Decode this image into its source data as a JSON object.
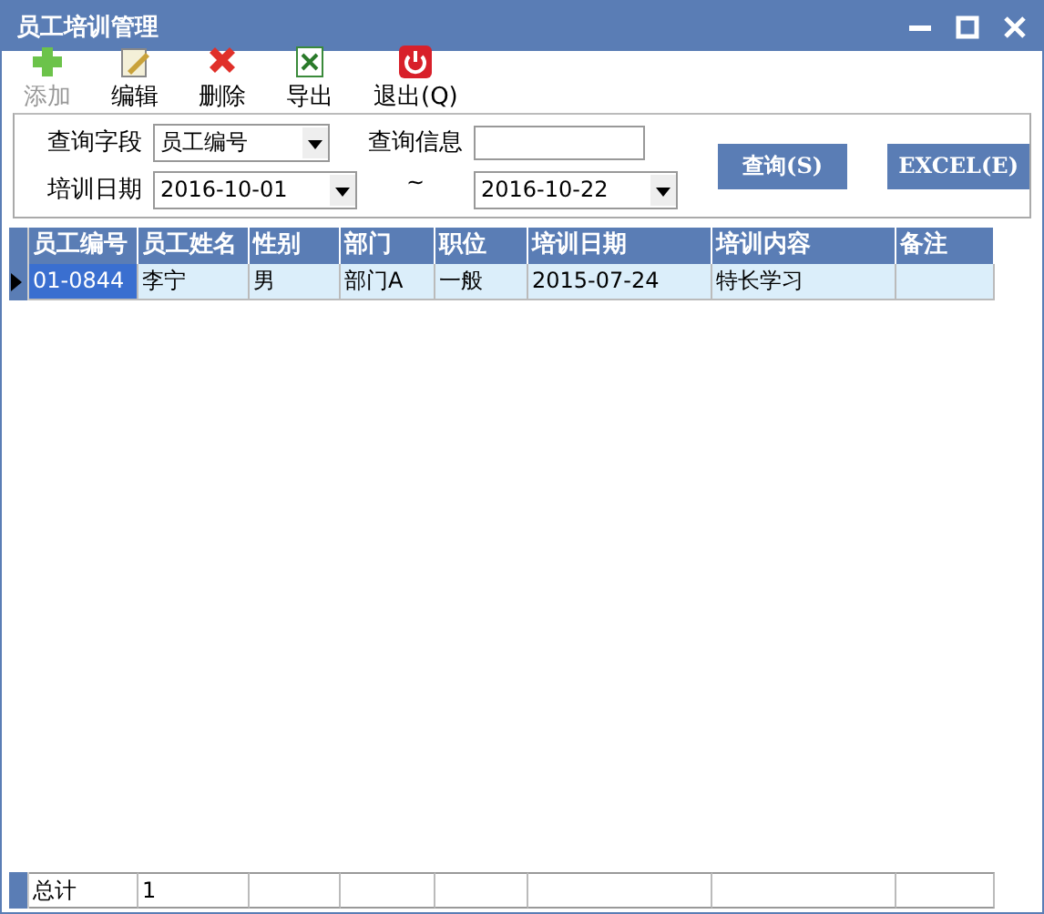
{
  "window": {
    "title": "员工培训管理"
  },
  "toolbar": [
    {
      "kind": "add",
      "label": "添加",
      "disabled": true
    },
    {
      "kind": "edit",
      "label": "编辑",
      "disabled": false
    },
    {
      "kind": "delete",
      "label": "删除",
      "disabled": false
    },
    {
      "kind": "export",
      "label": "导出",
      "disabled": false
    },
    {
      "kind": "exit",
      "label": "退出(Q)",
      "disabled": false
    }
  ],
  "query": {
    "field_label": "查询字段",
    "field_value": "员工编号",
    "info_label": "查询信息",
    "date_label": "培训日期",
    "date_from": "2016-10-01",
    "tilde": "~",
    "date_to": "2016-10-22",
    "search_button": "查询(S)",
    "excel_button": "EXCEL(E)"
  },
  "table": {
    "columns": [
      "员工编号",
      "员工姓名",
      "性别",
      "部门",
      "职位",
      "培训日期",
      "培训内容",
      "备注"
    ],
    "rows": [
      {
        "selected": true,
        "cells": [
          "01-0844",
          "李宁",
          "男",
          "部门A",
          "一般",
          "2015-07-24",
          "特长学习",
          null
        ]
      }
    ],
    "footer": [
      "总计",
      "1"
    ]
  }
}
